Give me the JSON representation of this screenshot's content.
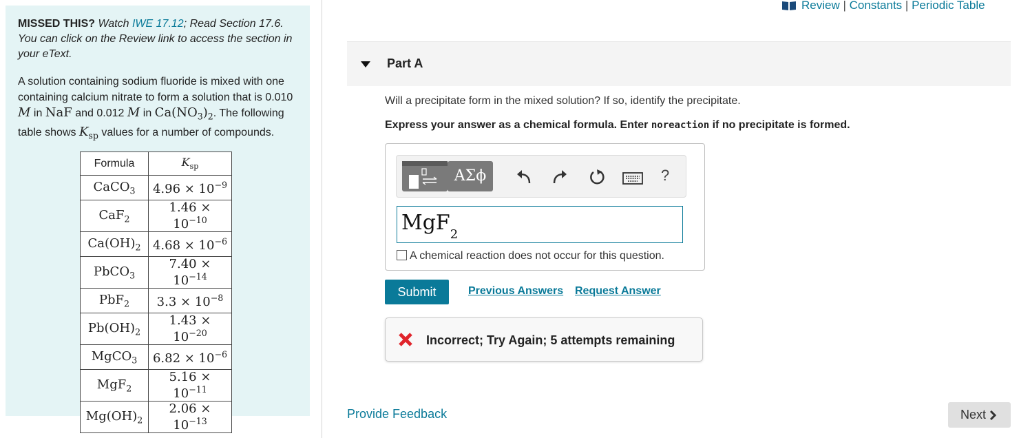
{
  "top_links": {
    "review": "Review",
    "separator": "|",
    "constants": "Constants",
    "periodic_table": "Periodic Table"
  },
  "left_panel": {
    "missed_label": "MISSED THIS?",
    "missed_watch": "Watch",
    "missed_link": "IWE 17.12",
    "missed_rest": "; Read Section 17.6. You can click on the Review link to access the section in your eText.",
    "problem": {
      "t1": "A solution containing sodium fluoride is mixed with one containing calcium nitrate to form a solution that is 0.010",
      "m": "M",
      "t2": "in",
      "naf": "NaF",
      "t3": "and 0.012",
      "t4": "in",
      "canitrate": "Ca(NO3)2",
      "t5": ". The following table shows",
      "ksp": "Ksp",
      "t6": "values for a number of compounds."
    },
    "ksp_table": {
      "headers": [
        "Formula",
        "Ksp"
      ],
      "rows": [
        [
          "CaCO3",
          "4.96 × 10−9"
        ],
        [
          "CaF2",
          "1.46 × 10−10"
        ],
        [
          "Ca(OH)2",
          "4.68 × 10−6"
        ],
        [
          "PbCO3",
          "7.40 × 10−14"
        ],
        [
          "PbF2",
          "3.3 × 10−8"
        ],
        [
          "Pb(OH)2",
          "1.43 × 10−20"
        ],
        [
          "MgCO3",
          "6.82 × 10−6"
        ],
        [
          "MgF2",
          "5.16 × 10−11"
        ],
        [
          "Mg(OH)2",
          "2.06 × 10−13"
        ]
      ]
    }
  },
  "part": {
    "title": "Part A",
    "question": "Will a precipitate form in the mixed solution? If so, identify the precipitate.",
    "instruction_pre": "Express your answer as a chemical formula. Enter",
    "instruction_code": "noreaction",
    "instruction_post": "if no precipitate is formed."
  },
  "toolbar": {
    "greek_label": "ΑΣϕ",
    "help_label": "?",
    "icons": [
      "template-icon",
      "undo-icon",
      "redo-icon",
      "reset-icon",
      "keyboard-icon",
      "help-icon"
    ]
  },
  "answer": {
    "value": "MgF2",
    "no_reaction_label": "A chemical reaction does not occur for this question."
  },
  "actions": {
    "submit": "Submit",
    "previous_answers": "Previous Answers",
    "request_answer": "Request Answer"
  },
  "feedback": {
    "message": "Incorrect; Try Again; 5 attempts remaining"
  },
  "footer": {
    "provide_feedback": "Provide Feedback",
    "next": "Next"
  },
  "colors": {
    "accent": "#0a7a99",
    "panel_bg": "#e4f4f5",
    "error": "#e0242b"
  }
}
